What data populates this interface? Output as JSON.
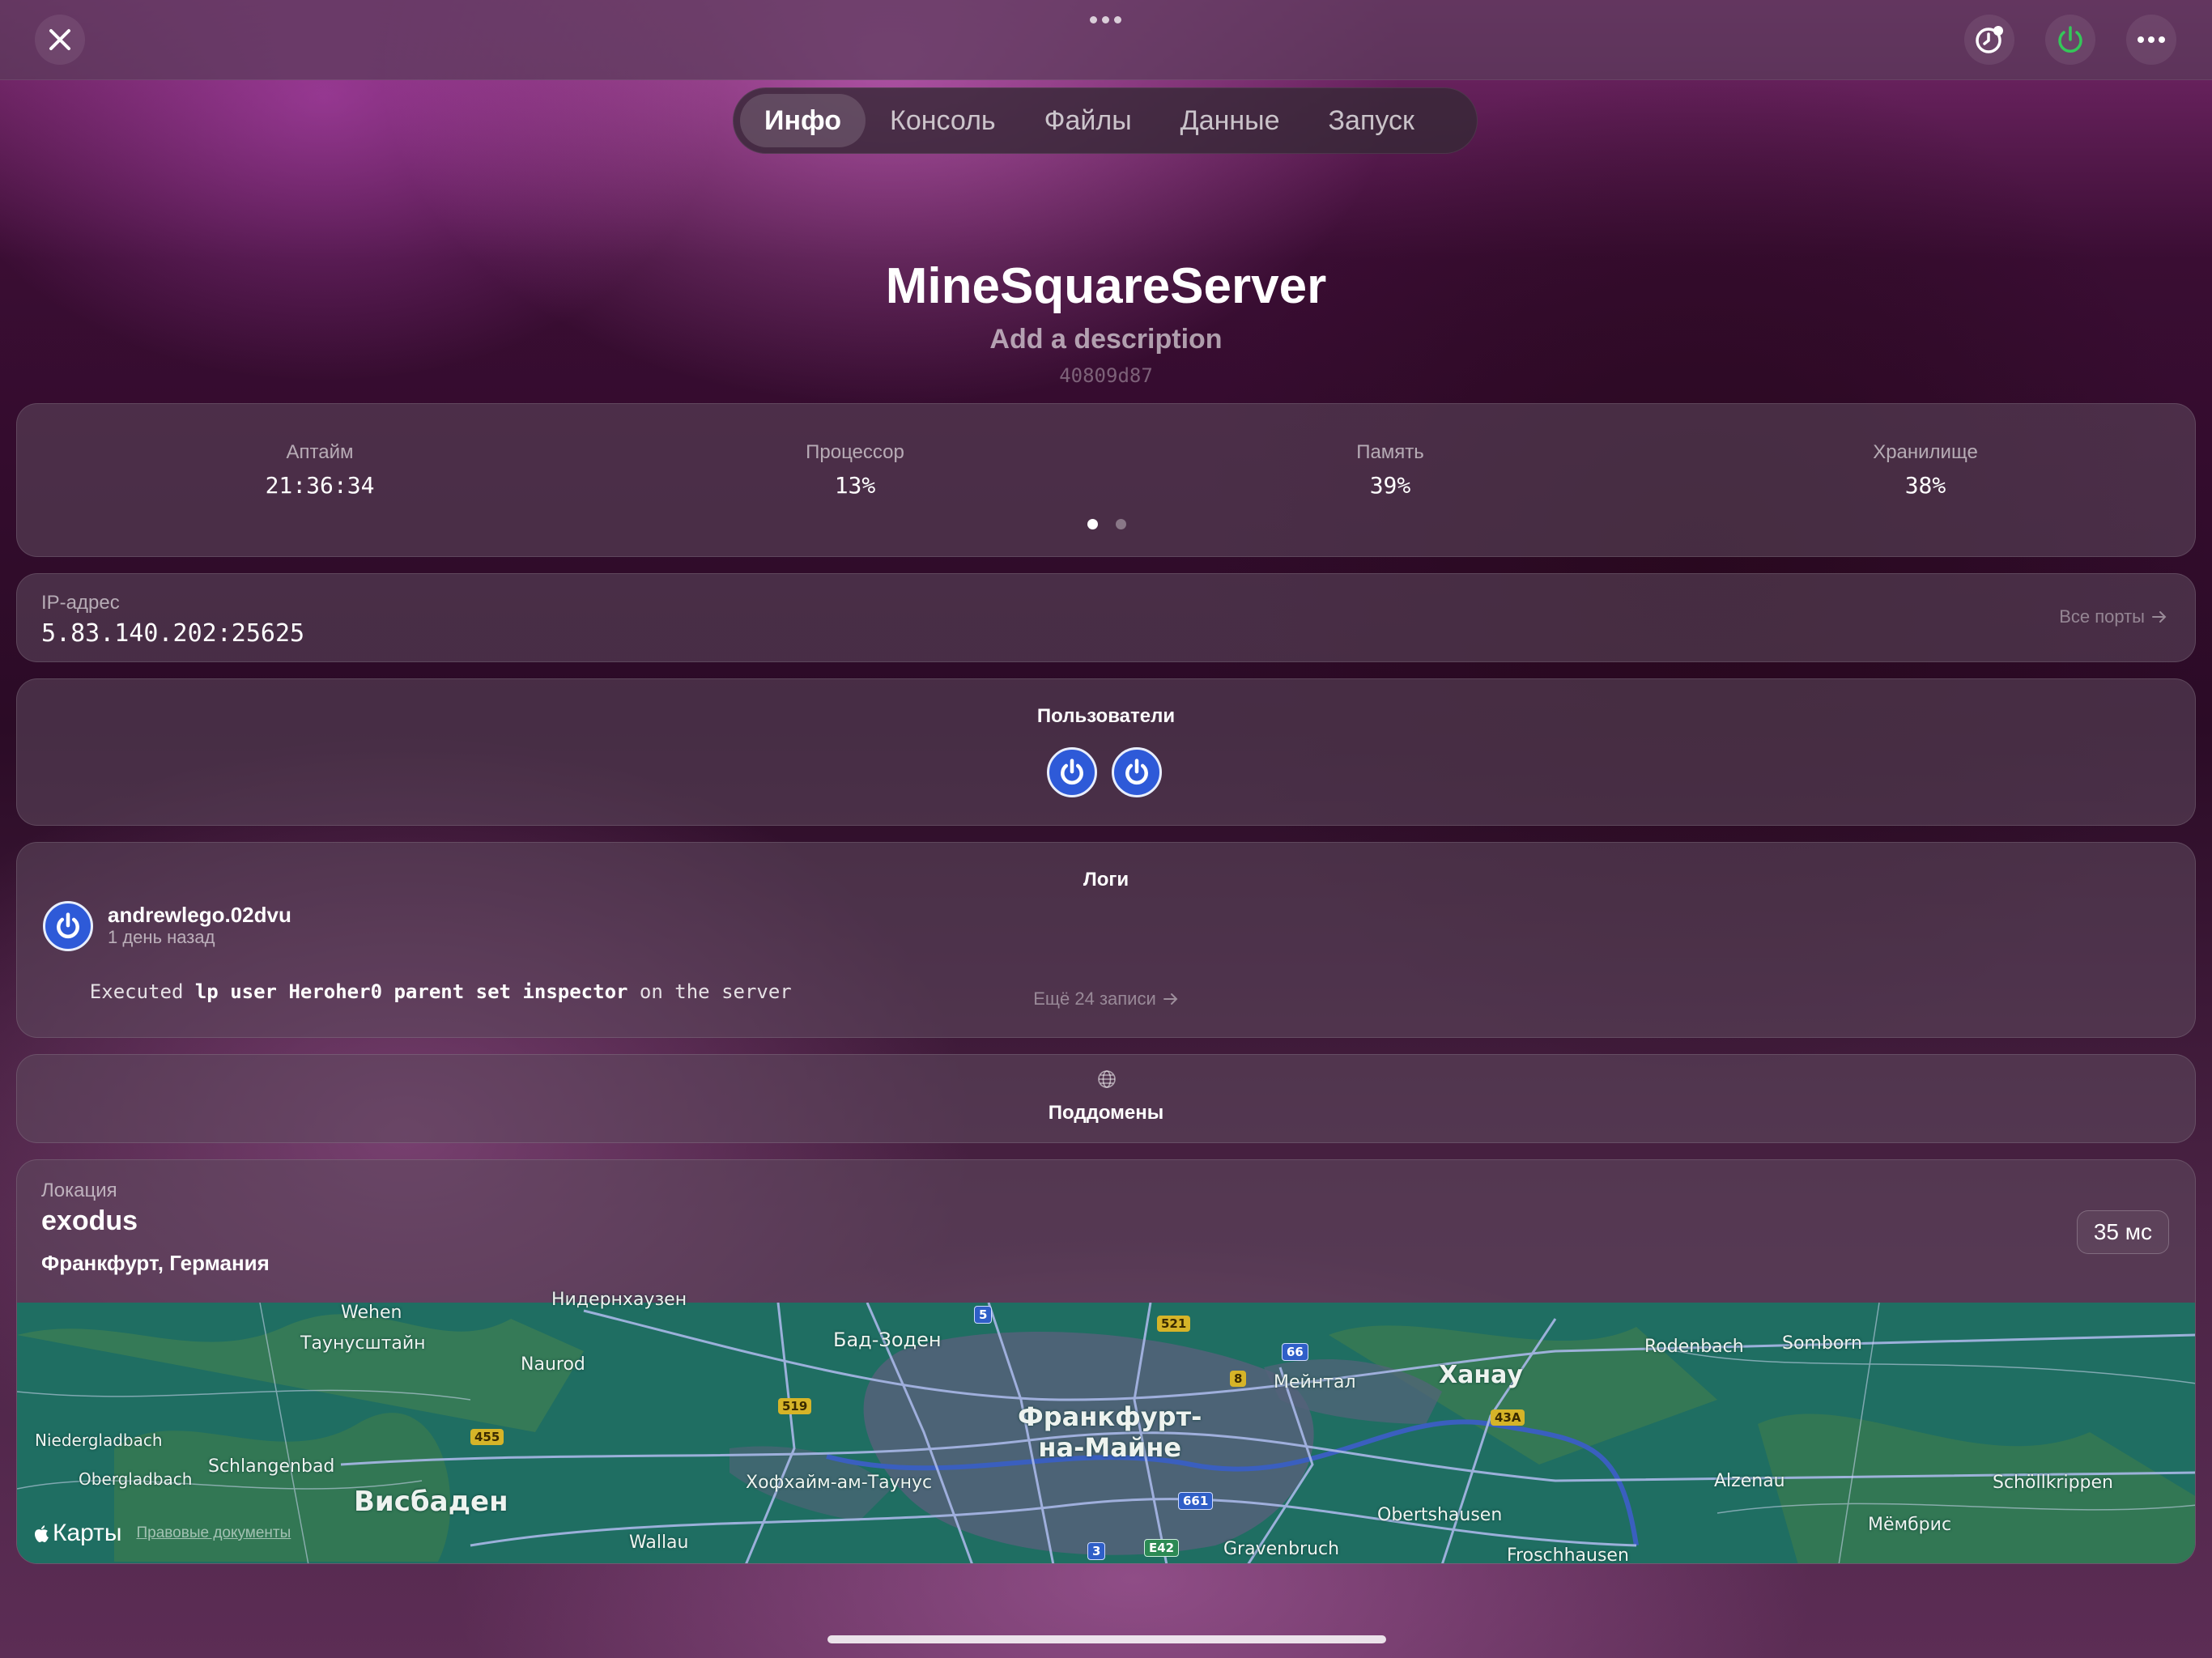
{
  "tabs": [
    "Инфо",
    "Консоль",
    "Файлы",
    "Данные",
    "Запуск"
  ],
  "server": {
    "name": "MineSquareServer",
    "description": "Add a description",
    "id": "40809d87"
  },
  "stats": [
    {
      "label": "Аптайм",
      "value": "21:36:34"
    },
    {
      "label": "Процессор",
      "value": "13%"
    },
    {
      "label": "Память",
      "value": "39%"
    },
    {
      "label": "Хранилище",
      "value": "38%"
    }
  ],
  "ip": {
    "label": "IP-адрес",
    "value": "5.83.140.202:25625",
    "all_ports": "Все порты"
  },
  "users": {
    "title": "Пользователи",
    "count": 2
  },
  "logs": {
    "title": "Логи",
    "user": "andrewlego.02dvu",
    "time": "1 день назад",
    "msg_prefix": "Executed ",
    "msg_cmd": "lp user Heroher0 parent set inspector",
    "msg_suffix": " on the server",
    "more": "Ещё 24 записи"
  },
  "subdomains": {
    "title": "Поддомены"
  },
  "location": {
    "label": "Локация",
    "node": "exodus",
    "city": "Франкфурт, Германия",
    "ping": "35 мс"
  },
  "map": {
    "brand": "Карты",
    "legal": "Правовые документы",
    "labels": {
      "wehen": "Wehen",
      "taunusstein": "Таунусштайн",
      "niedernhausen": "Нидернхаузен",
      "naurod": "Naurod",
      "bad_soden": "Бад-Зоден",
      "niedergladbach": "Niedergladbach",
      "obergladbach": "Obergladbach",
      "schlangenbad": "Schlangenbad",
      "wiesbaden": "Висбаден",
      "wallau": "Wallau",
      "frankfurt": "Франкфурт-\nна-Майне",
      "hofheim": "Хофхайм-ам-Таунус",
      "maintal": "Мейнтал",
      "hanau": "Ханау",
      "rodenbach": "Rodenbach",
      "somborn": "Somborn",
      "alzenau": "Alzenau",
      "schoellkrippen": "Schöllkrippen",
      "mombris": "Мёмбрис",
      "obertshausen": "Obertshausen",
      "gravenbruch": "Gravenbruch",
      "froschhausen": "Froschhausen"
    },
    "highways": {
      "a5": "5",
      "b521": "521",
      "a66": "66",
      "b8": "8",
      "b519": "519",
      "b455": "455",
      "b43a": "43A",
      "a661": "661",
      "a3": "3",
      "e42": "E42"
    }
  }
}
